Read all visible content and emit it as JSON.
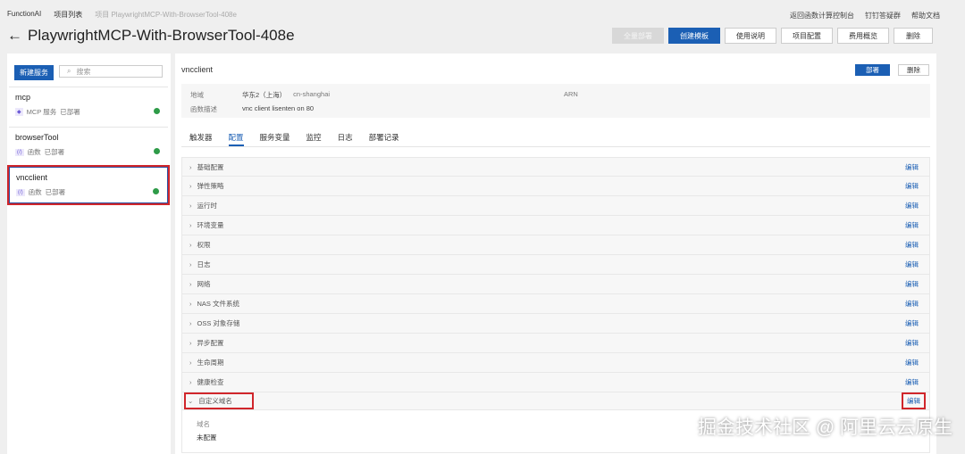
{
  "breadcrumb": [
    "FunctionAI",
    "项目列表",
    "项目 PlaywrightMCP-With-BrowserTool-408e"
  ],
  "top_links": [
    "返回函数计算控制台",
    "钉钉答疑群",
    "帮助文档"
  ],
  "title": "PlaywrightMCP-With-BrowserTool-408e",
  "buttons": {
    "deploy_all": "全量部署",
    "create_template": "创建模板",
    "usage": "使用说明",
    "project_config": "项目配置",
    "cost": "费用概览",
    "delete": "删除"
  },
  "sidebar": {
    "new_service": "新建服务",
    "search_placeholder": "搜索",
    "services": [
      {
        "name": "mcp",
        "icon": "MCP",
        "type": "MCP 服务",
        "status": "已部署"
      },
      {
        "name": "browserTool",
        "icon": "(/)",
        "type": "函数",
        "status": "已部署"
      },
      {
        "name": "vncclient",
        "icon": "(/)",
        "type": "函数",
        "status": "已部署"
      }
    ]
  },
  "main": {
    "name": "vncclient",
    "deploy": "部署",
    "delete": "删除",
    "info": {
      "region_label": "地域",
      "region": "华东2（上海）",
      "region_id": "cn-shanghai",
      "arn_label": "ARN",
      "desc_label": "函数描述",
      "desc": "vnc client lisenten on 80"
    },
    "tabs": [
      "触发器",
      "配置",
      "服务变量",
      "监控",
      "日志",
      "部署记录"
    ],
    "edit_label": "编辑",
    "config_rows": [
      "基础配置",
      "弹性策略",
      "运行时",
      "环境变量",
      "权限",
      "日志",
      "网络",
      "NAS 文件系统",
      "OSS 对象存储",
      "异步配置",
      "生命周期",
      "健康检查"
    ],
    "expanded": {
      "title": "自定义域名",
      "field": "域名",
      "value": "未配置"
    }
  },
  "watermark": "掘金技术社区 @ 阿里云云原生"
}
